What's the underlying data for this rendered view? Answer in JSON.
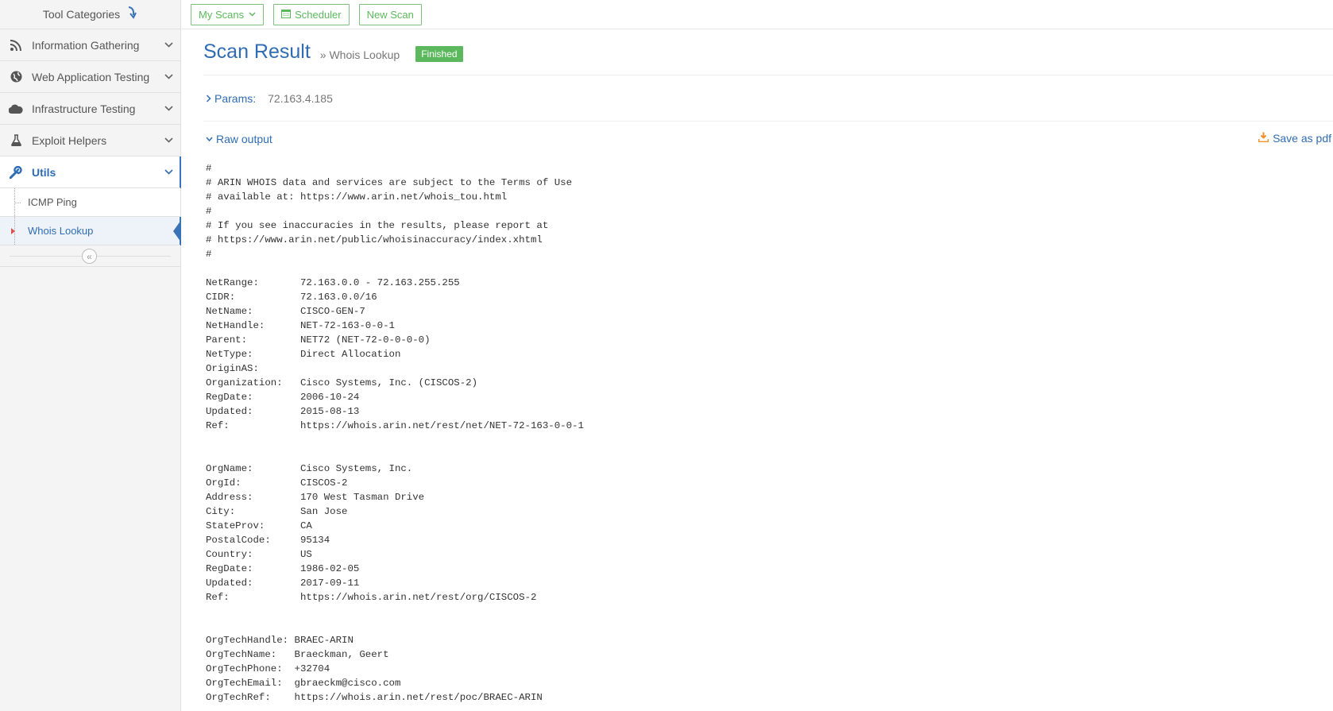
{
  "sidebar": {
    "header": "Tool Categories",
    "items": [
      {
        "label": "Information Gathering"
      },
      {
        "label": "Web Application Testing"
      },
      {
        "label": "Infrastructure Testing"
      },
      {
        "label": "Exploit Helpers"
      },
      {
        "label": "Utils"
      }
    ],
    "subitems": [
      {
        "label": "ICMP Ping"
      },
      {
        "label": "Whois Lookup"
      }
    ]
  },
  "toolbar": {
    "my_scans": "My Scans",
    "scheduler": "Scheduler",
    "new_scan": "New Scan"
  },
  "main": {
    "title": "Scan Result",
    "breadcrumb": "» Whois Lookup",
    "status": "Finished",
    "params_label": "Params:",
    "params_value": "72.163.4.185",
    "raw_output_label": "Raw output",
    "save_pdf": "Save as pdf",
    "output_text": "#\n# ARIN WHOIS data and services are subject to the Terms of Use\n# available at: https://www.arin.net/whois_tou.html\n#\n# If you see inaccuracies in the results, please report at\n# https://www.arin.net/public/whoisinaccuracy/index.xhtml\n#\n\nNetRange:       72.163.0.0 - 72.163.255.255\nCIDR:           72.163.0.0/16\nNetName:        CISCO-GEN-7\nNetHandle:      NET-72-163-0-0-1\nParent:         NET72 (NET-72-0-0-0-0)\nNetType:        Direct Allocation\nOriginAS:\nOrganization:   Cisco Systems, Inc. (CISCOS-2)\nRegDate:        2006-10-24\nUpdated:        2015-08-13\nRef:            https://whois.arin.net/rest/net/NET-72-163-0-0-1\n\n\nOrgName:        Cisco Systems, Inc.\nOrgId:          CISCOS-2\nAddress:        170 West Tasman Drive\nCity:           San Jose\nStateProv:      CA\nPostalCode:     95134\nCountry:        US\nRegDate:        1986-02-05\nUpdated:        2017-09-11\nRef:            https://whois.arin.net/rest/org/CISCOS-2\n\n\nOrgTechHandle: BRAEC-ARIN\nOrgTechName:   Braeckman, Geert\nOrgTechPhone:  +32704\nOrgTechEmail:  gbraeckm@cisco.com\nOrgTechRef:    https://whois.arin.net/rest/poc/BRAEC-ARIN"
  },
  "colors": {
    "accent": "#2f6cb3",
    "success": "#5cb85c",
    "download": "#f0932b"
  }
}
